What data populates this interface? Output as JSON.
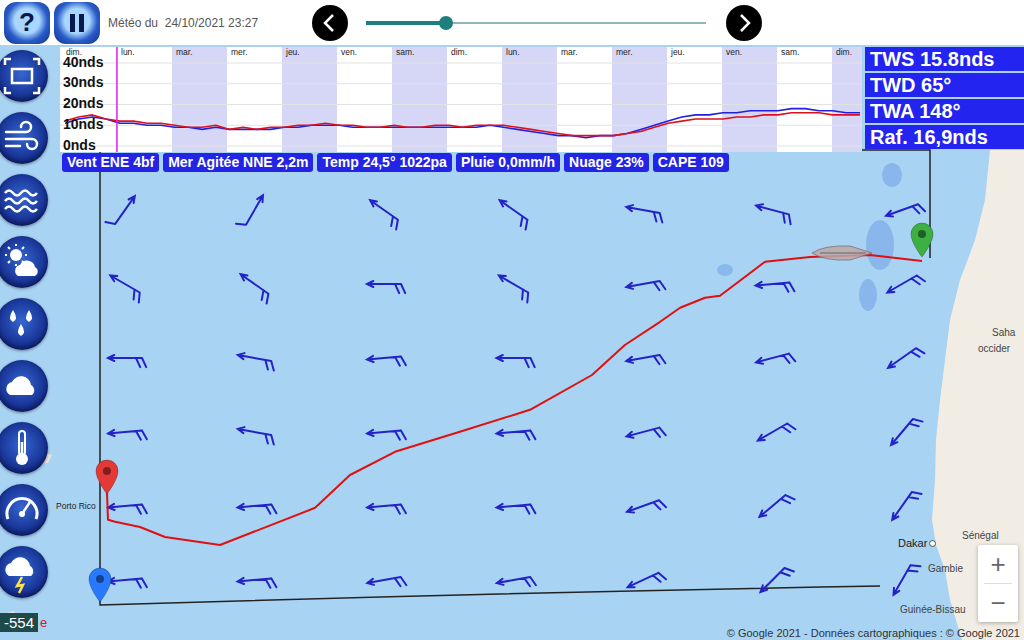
{
  "top_bar": {
    "help": "?",
    "weather_time": "Météo du  24/10/2021 23:27",
    "timeline": {
      "level": 0.235
    }
  },
  "chart": {
    "y_max": 40,
    "y_ticks": [
      "40nds",
      "30nds",
      "20nds",
      "10nds",
      "0nds"
    ],
    "cursor_level": 0.071,
    "days": [
      {
        "label": "dim.",
        "shaded": false
      },
      {
        "label": "lun.",
        "shaded": false
      },
      {
        "label": "mar.",
        "shaded": true
      },
      {
        "label": "mer.",
        "shaded": false
      },
      {
        "label": "jeu.",
        "shaded": true
      },
      {
        "label": "ven.",
        "shaded": false
      },
      {
        "label": "sam.",
        "shaded": true
      },
      {
        "label": "dim.",
        "shaded": false
      },
      {
        "label": "lun.",
        "shaded": true
      },
      {
        "label": "mar.",
        "shaded": false
      },
      {
        "label": "mer.",
        "shaded": true
      },
      {
        "label": "jeu.",
        "shaded": false
      },
      {
        "label": "ven.",
        "shaded": true
      },
      {
        "label": "sam.",
        "shaded": false
      },
      {
        "label": "dim.",
        "shaded": true
      }
    ],
    "series": [
      {
        "name": "blue",
        "color": "#2020e0",
        "values": [
          11,
          13,
          14,
          13,
          11,
          11,
          10,
          10,
          9,
          9,
          8,
          9,
          8,
          8,
          8,
          8,
          9,
          9,
          10,
          10,
          10,
          9,
          9,
          9,
          9,
          9,
          9,
          9,
          9,
          9,
          9,
          10,
          9,
          8,
          7,
          6,
          5,
          5,
          4,
          5,
          5,
          6,
          8,
          10,
          12,
          14,
          15,
          15,
          16,
          16,
          17,
          17,
          17,
          18,
          18,
          17,
          17,
          16,
          16
        ]
      },
      {
        "name": "red",
        "color": "#e0101a",
        "values": [
          12,
          14,
          15,
          13,
          12,
          12,
          11,
          11,
          10,
          9,
          9,
          10,
          8,
          9,
          8,
          9,
          9,
          10,
          10,
          11,
          10,
          10,
          9,
          9,
          10,
          9,
          9,
          10,
          10,
          9,
          10,
          10,
          10,
          9,
          8,
          7,
          6,
          5,
          5,
          5,
          5,
          6,
          7,
          9,
          11,
          12,
          13,
          13,
          13,
          14,
          14,
          15,
          15,
          16,
          16,
          16,
          15,
          15,
          15
        ]
      }
    ]
  },
  "stats": [
    "TWS 15.8nds",
    "TWD 65°",
    "TWA 148°",
    "Raf. 16,9nds"
  ],
  "conditions": [
    "Vent ENE 4bf",
    "Mer Agitée NNE 2,2m",
    "Temp 24,5° 1022pa",
    "Pluie 0,0mm/h",
    "Nuage 23%",
    "CAPE 109"
  ],
  "map": {
    "wind": [
      [
        {
          "dir": -55,
          "barbs": 1
        },
        {
          "dir": -60,
          "barbs": 1
        },
        {
          "dir": -145,
          "barbs": 2
        },
        {
          "dir": -145,
          "barbs": 2
        },
        {
          "dir": -170,
          "barbs": 2
        },
        {
          "dir": -165,
          "barbs": 2
        },
        {
          "dir": 160,
          "barbs": 2
        }
      ],
      [
        {
          "dir": -150,
          "barbs": 2
        },
        {
          "dir": -145,
          "barbs": 2
        },
        {
          "dir": 180,
          "barbs": 2
        },
        {
          "dir": -150,
          "barbs": 2
        },
        {
          "dir": 170,
          "barbs": 2
        },
        {
          "dir": 175,
          "barbs": 2
        },
        {
          "dir": 150,
          "barbs": 2
        }
      ],
      [
        {
          "dir": 180,
          "barbs": 2
        },
        {
          "dir": -170,
          "barbs": 2
        },
        {
          "dir": 175,
          "barbs": 2
        },
        {
          "dir": 180,
          "barbs": 2
        },
        {
          "dir": 170,
          "barbs": 2
        },
        {
          "dir": 165,
          "barbs": 2
        },
        {
          "dir": 145,
          "barbs": 2
        }
      ],
      [
        {
          "dir": 175,
          "barbs": 2
        },
        {
          "dir": -170,
          "barbs": 2
        },
        {
          "dir": 175,
          "barbs": 2
        },
        {
          "dir": 175,
          "barbs": 2
        },
        {
          "dir": 165,
          "barbs": 2
        },
        {
          "dir": 150,
          "barbs": 2
        },
        {
          "dir": 130,
          "barbs": 2
        }
      ],
      [
        {
          "dir": 175,
          "barbs": 2
        },
        {
          "dir": 175,
          "barbs": 2
        },
        {
          "dir": 175,
          "barbs": 2
        },
        {
          "dir": 175,
          "barbs": 2
        },
        {
          "dir": 160,
          "barbs": 2
        },
        {
          "dir": 140,
          "barbs": 2
        },
        {
          "dir": 125,
          "barbs": 2
        }
      ],
      [
        {
          "dir": 175,
          "barbs": 2
        },
        {
          "dir": 175,
          "barbs": 2
        },
        {
          "dir": 170,
          "barbs": 2
        },
        {
          "dir": 170,
          "barbs": 2
        },
        {
          "dir": 155,
          "barbs": 2
        },
        {
          "dir": 135,
          "barbs": 2
        },
        {
          "dir": 120,
          "barbs": 2
        }
      ]
    ],
    "route": [
      [
        -20.16,
        24.6
      ],
      [
        -22.97,
        24.75
      ],
      [
        -26.22,
        24.7
      ],
      [
        -28.65,
        24.58
      ],
      [
        -31.08,
        23.73
      ],
      [
        -31.89,
        23.68
      ],
      [
        -33.24,
        23.43
      ],
      [
        -34.32,
        23.08
      ],
      [
        -36.22,
        22.5
      ],
      [
        -38.0,
        21.75
      ],
      [
        -41.35,
        20.88
      ],
      [
        -45.14,
        20.33
      ],
      [
        -48.65,
        19.83
      ],
      [
        -51.08,
        19.25
      ],
      [
        -52.97,
        18.43
      ],
      [
        -58.11,
        17.5
      ],
      [
        -61.08,
        17.7
      ],
      [
        -62.43,
        17.95
      ],
      [
        -63.78,
        18.08
      ],
      [
        -64.16,
        18.13
      ],
      [
        -64.22,
        18.88
      ]
    ],
    "pins": [
      {
        "kind": "start",
        "color": "#3cb043",
        "lon": -20.16,
        "lat": 24.68
      },
      {
        "kind": "end",
        "color": "#e53935",
        "lon": -64.22,
        "lat": 18.75
      },
      {
        "kind": "marker",
        "color": "#2979ff",
        "lon": -64.59,
        "lat": 16.05
      }
    ],
    "boat": {
      "lon": -24.49,
      "lat": 24.8
    },
    "labels": [
      {
        "text": "Porto Rico",
        "kind": "island",
        "lon": -66.97,
        "lat": 18.63
      },
      {
        "text": "Dakar",
        "kind": "city",
        "lon": -21.46,
        "lat": 17.7
      },
      {
        "text": "Sénégal",
        "kind": "country",
        "lon": -18.0,
        "lat": 17.88
      },
      {
        "text": "Gambie",
        "kind": "country",
        "lon": -19.84,
        "lat": 17.05
      },
      {
        "text": "Guinée-Bissau",
        "kind": "country",
        "lon": -21.35,
        "lat": 16.02
      },
      {
        "text": "Saha",
        "kind": "country",
        "lon": -16.38,
        "lat": 22.95
      },
      {
        "text": "occider",
        "kind": "country",
        "lon": -17.14,
        "lat": 22.55
      }
    ]
  },
  "depth_badge": {
    "value": "-554",
    "suffix": "e"
  },
  "zoom": {
    "in": "+",
    "out": "−"
  },
  "copyright": "© Google 2021 - Données cartographiques : © Google 2021"
}
